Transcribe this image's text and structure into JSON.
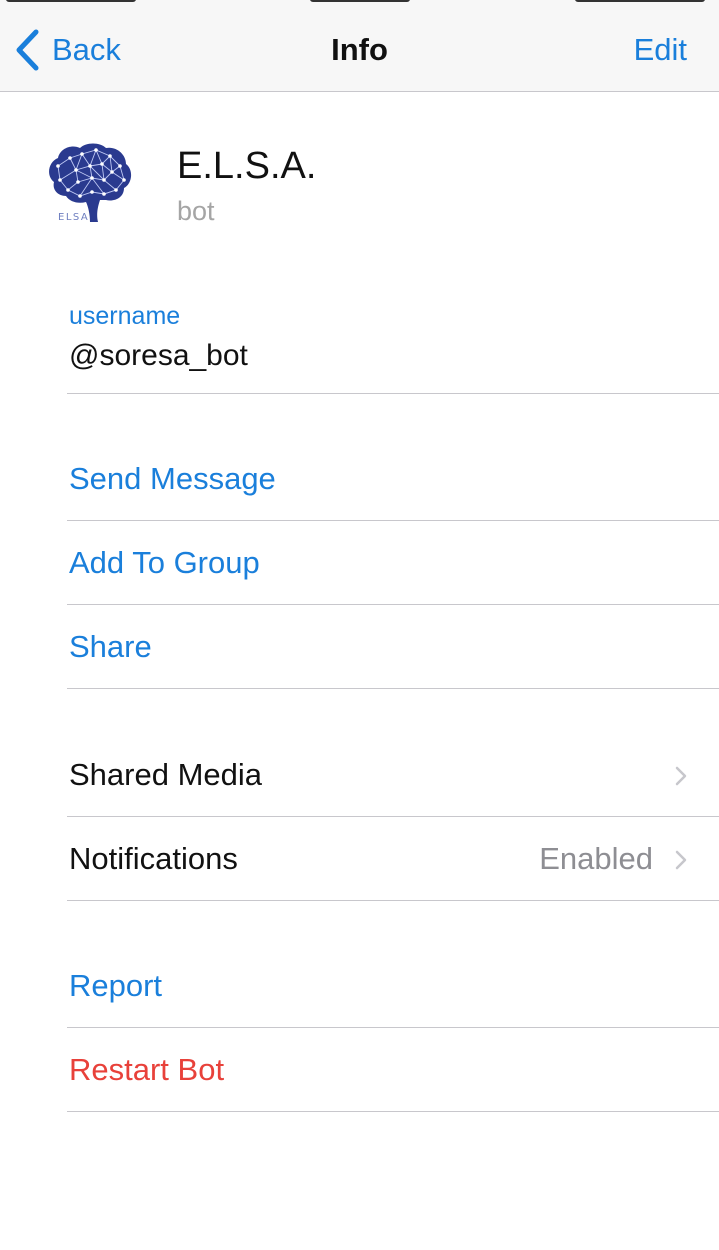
{
  "navbar": {
    "back_label": "Back",
    "title": "Info",
    "edit_label": "Edit"
  },
  "profile": {
    "name": "E.L.S.A.",
    "subtitle": "bot",
    "avatar_text": "ELSA",
    "avatar_color": "#2a3a8f"
  },
  "username": {
    "label": "username",
    "value": "@soresa_bot"
  },
  "actions": {
    "send_message": "Send Message",
    "add_to_group": "Add To Group",
    "share": "Share"
  },
  "settings": {
    "shared_media": "Shared Media",
    "notifications": "Notifications",
    "notifications_value": "Enabled"
  },
  "danger": {
    "report": "Report",
    "restart_bot": "Restart Bot"
  },
  "colors": {
    "accent": "#1a7fdb",
    "destructive": "#e8413a",
    "secondary_text": "#8e8e93"
  }
}
